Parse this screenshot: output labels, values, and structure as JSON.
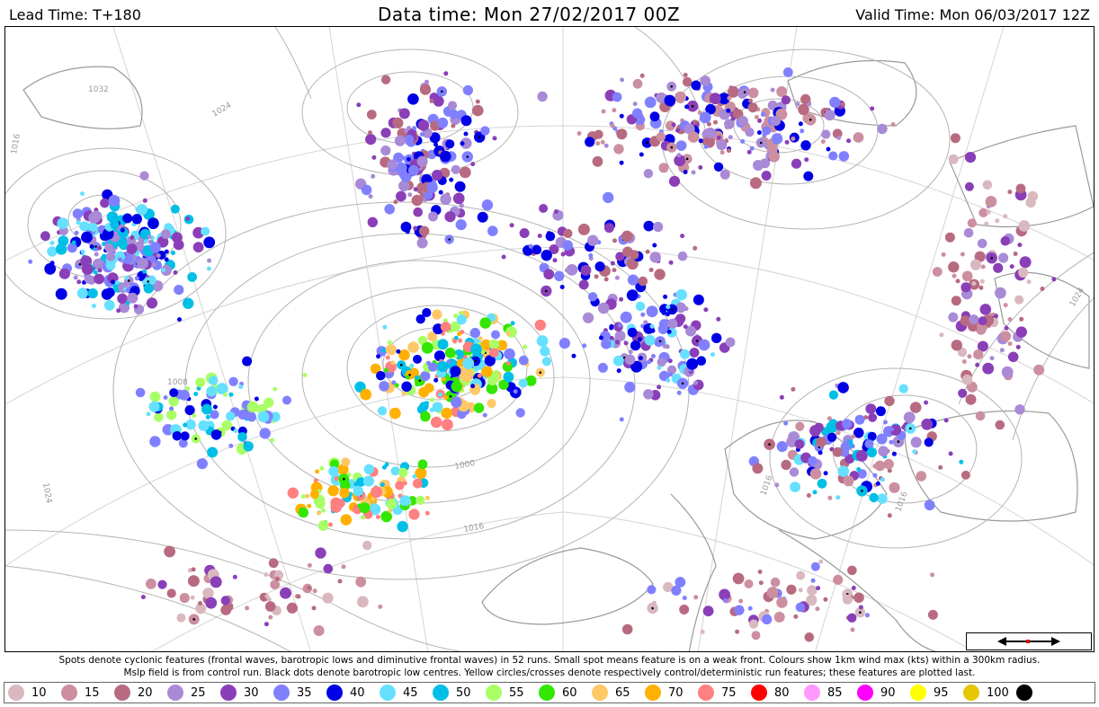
{
  "header": {
    "lead_time": "Lead Time: T+180",
    "data_time": "Data time:  Mon 27/02/2017 00Z",
    "valid_time": "Valid Time: Mon 06/03/2017 12Z"
  },
  "caption": {
    "line1": "Spots denote cyclonic features (frontal waves, barotropic lows and diminutive frontal waves) in 52 runs. Small spot means feature is on a weak front. Colours show 1km wind max (kts) within a 300km radius.",
    "line2": "Mslp field is from control run. Black dots denote barotropic low centres. Yellow circles/crosses denote respectively control/deterministic run features; these features are plotted last."
  },
  "map": {
    "isobar_labels": [
      "1032",
      "1024",
      "1016",
      "1008",
      "1000",
      "1016",
      "1024",
      "1016",
      "1024",
      "1016"
    ],
    "background_color": "#ffffff",
    "isobar_color": "#b4b4b4",
    "coast_color": "#9a9a9a"
  },
  "legend": [
    {
      "label": "10",
      "color": "#d9b8bf"
    },
    {
      "label": "15",
      "color": "#cc8fa0"
    },
    {
      "label": "20",
      "color": "#b86b80"
    },
    {
      "label": "25",
      "color": "#a98ad6"
    },
    {
      "label": "30",
      "color": "#8a3fb8"
    },
    {
      "label": "35",
      "color": "#8080ff"
    },
    {
      "label": "40",
      "color": "#0000e6"
    },
    {
      "label": "45",
      "color": "#66e0ff"
    },
    {
      "label": "50",
      "color": "#00bfe6"
    },
    {
      "label": "55",
      "color": "#a8ff66"
    },
    {
      "label": "60",
      "color": "#33e600"
    },
    {
      "label": "65",
      "color": "#ffc866"
    },
    {
      "label": "70",
      "color": "#ffb000"
    },
    {
      "label": "75",
      "color": "#ff8080"
    },
    {
      "label": "80",
      "color": "#ff0000"
    },
    {
      "label": "85",
      "color": "#ff99ff"
    },
    {
      "label": "90",
      "color": "#ff00ff"
    },
    {
      "label": "95",
      "color": "#ffff00"
    },
    {
      "label": "100",
      "color": "#e6c600"
    },
    {
      "label": "",
      "color": "#000000"
    }
  ]
}
